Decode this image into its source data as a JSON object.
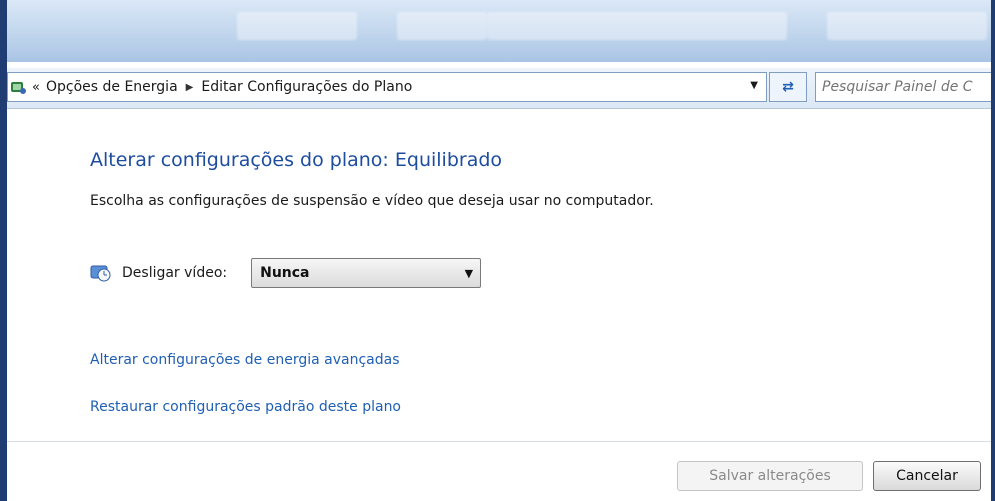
{
  "nav": {
    "back_chevrons": "«",
    "breadcrumb": [
      "Opções de Energia",
      "Editar Configurações do Plano"
    ],
    "search_placeholder": "Pesquisar Painel de C"
  },
  "main": {
    "heading": "Alterar configurações do plano: Equilibrado",
    "description": "Escolha as configurações de suspensão e vídeo que deseja usar no computador.",
    "display_off_label": "Desligar vídeo:",
    "display_off_value": "Nunca",
    "link_advanced": "Alterar configurações de energia avançadas",
    "link_restore": "Restaurar configurações padrão deste plano"
  },
  "footer": {
    "save_label": "Salvar alterações",
    "cancel_label": "Cancelar"
  },
  "colors": {
    "heading": "#1e4da0",
    "link": "#1f5fb3",
    "frame_border": "#1f3d73"
  },
  "icons": [
    "control-panel-icon",
    "breadcrumb-arrow-icon",
    "dropdown-arrow-icon",
    "refresh-icon",
    "display-clock-icon"
  ]
}
